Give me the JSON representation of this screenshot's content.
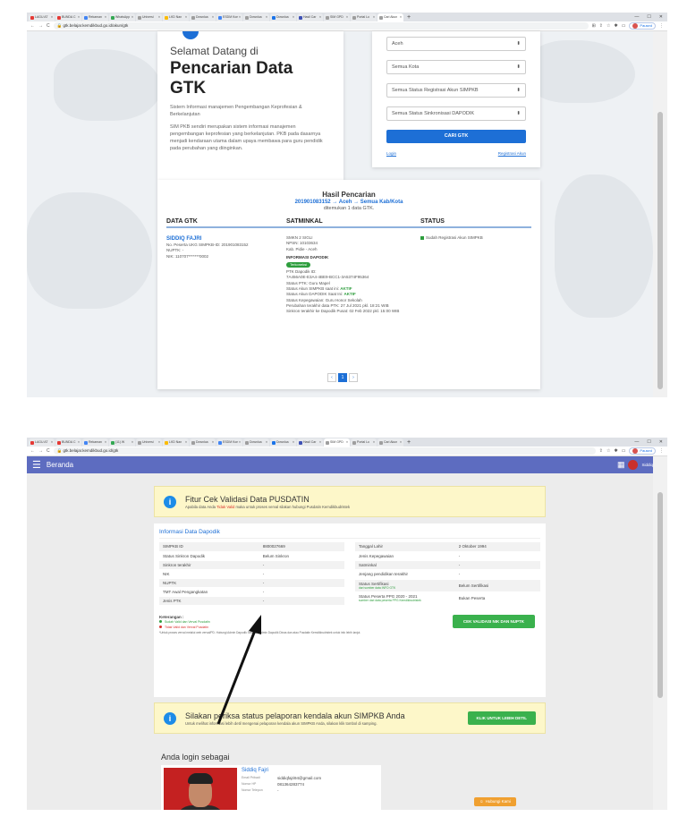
{
  "shot1": {
    "tabs": [
      {
        "label": "LAGU AT",
        "color": "#e53935"
      },
      {
        "label": "BUNDA C",
        "color": "#e53935"
      },
      {
        "label": "Rekaman",
        "color": "#4285f4"
      },
      {
        "label": "WhatsApp",
        "color": "#34a853"
      },
      {
        "label": "Universi",
        "color": "#9e9e9e"
      },
      {
        "label": "LKD Nan",
        "color": "#fbbc05"
      },
      {
        "label": "Downloa",
        "color": "#9e9e9e"
      },
      {
        "label": "ESDM Kon",
        "color": "#4285f4"
      },
      {
        "label": "Downloa",
        "color": "#9e9e9e"
      },
      {
        "label": "Downloa",
        "color": "#1a73e8"
      },
      {
        "label": "Hasil Car",
        "color": "#3f51b5"
      },
      {
        "label": "SIM GPD",
        "color": "#9e9e9e"
      },
      {
        "label": "Portal Lo",
        "color": "#9e9e9e"
      },
      {
        "label": "Cari Akun",
        "color": "#9e9e9e"
      }
    ],
    "url": "gtk.belajar.kemdikbud.go.id/akun/gtk",
    "profile_label": "Paused",
    "welcome": {
      "heading": "Selamat Datang di",
      "title": "Pencarian Data GTK",
      "subtitle": "Sistem Informasi manajemen Pengembangan Keprofesian & Berkelanjutan",
      "paragraph": "SIM PKB sendiri merupakan sistem informasi manajemen pengembangan keprofesian yang berkelanjutan. PKB pada dasarnya menjadi kendaraan utama dalam upaya membawa para guru pendidik pada perubahan yang diinginkan."
    },
    "filters": {
      "province": "Aceh",
      "city": "Semua Kota",
      "registration_status": "Semua Status Registrasi Akun SIMPKB",
      "sync_status": "Semua Status Sinkronisasi DAPODIK",
      "search_button": "CARI GTK",
      "login_link": "Login",
      "register_link": "Registrasi Akun"
    },
    "result": {
      "title": "Hasil Pencarian",
      "query": "201901083152 → Aceh → Semua Kab/Kota",
      "count_text": "ditemukan 1 data GTK.",
      "headers": [
        "DATA GTK",
        "SATMINKAL",
        "STATUS"
      ],
      "name": "SIDDIQ FAJRI",
      "gtk_lines": [
        "No. Peserta UKG SIMPKB-ID: 201901083152",
        "NUPTK: -",
        "NIK: 110707*******0002"
      ],
      "school_lines": [
        "SMKN 2 SIGLI",
        "NPSN: 10103634",
        "Kab. Pidie - Aceh"
      ],
      "dapodik_label": "INFORMASI DAPODIK",
      "dapodik_badge": "Terkoneksi",
      "dapodik_lines": [
        "PTK Dapodik ID:",
        "7A456A0E-E3A4-4BE9-BCC1-3A5374F95364",
        "Status PTK: Guru Mapel",
        "Status Akun SIMPKB saat ini: AKTIF",
        "Status Akun DAPODIK Saat Ini: AKTIF",
        "Status Kepegawaian: Guru Honor Sekolah",
        "Perubahan terakhir data PTK: 27 Jul 2021 pkl. 18:21 WIB",
        "Sinkron terakhir ke Dapodik Pusat: 02 Feb 2022 pkl. 15:00 WIB"
      ],
      "status_text": "Sudah Registrasi Akun SIMPKB",
      "pages": [
        "‹",
        "1",
        "›"
      ]
    }
  },
  "shot2": {
    "tabs": [
      {
        "label": "LAGU AT",
        "color": "#e53935"
      },
      {
        "label": "BUNDA C",
        "color": "#e53935"
      },
      {
        "label": "Rekaman",
        "color": "#4285f4"
      },
      {
        "label": "(11) W",
        "color": "#34a853"
      },
      {
        "label": "Universi",
        "color": "#9e9e9e"
      },
      {
        "label": "LKD Nan",
        "color": "#fbbc05"
      },
      {
        "label": "Downloa",
        "color": "#9e9e9e"
      },
      {
        "label": "ESDM Kon",
        "color": "#4285f4"
      },
      {
        "label": "Downloa",
        "color": "#9e9e9e"
      },
      {
        "label": "Downloa",
        "color": "#1a73e8"
      },
      {
        "label": "Hasil Car",
        "color": "#3f51b5"
      },
      {
        "label": "SIM GPD",
        "color": "#9e9e9e"
      },
      {
        "label": "Portal Lo",
        "color": "#9e9e9e"
      },
      {
        "label": "Cari Akun",
        "color": "#9e9e9e"
      }
    ],
    "url": "gtk.belajar.kemdikbud.go.id/gtk",
    "profile_label": "Paused",
    "app_title": "Beranda",
    "user_name": "Siddiq Fajri",
    "alert1": {
      "title": "Fitur Cek Validasi Data PUSDATIN",
      "text_pre": "Apabila data Anda",
      "text_red": "Tidak Valid",
      "text_post": "maka untuk proses verval silakan hubungi Pusdatin Kemdikbudristek"
    },
    "info": {
      "title": "Informasi Data Dapodik",
      "left": [
        {
          "k": "SIMPKB ID",
          "v": "8800027669"
        },
        {
          "k": "Status Sinkron Dapodik",
          "v": "Belum Sinkron"
        },
        {
          "k": "Sinkron terakhir",
          "v": "-"
        },
        {
          "k": "NIK",
          "v": "-"
        },
        {
          "k": "NUPTK",
          "v": "-"
        },
        {
          "k": "TMT Awal Pengangkatan",
          "v": "-"
        },
        {
          "k": "Jenis PTK",
          "v": "-"
        }
      ],
      "right": [
        {
          "k": "Tanggal Lahir",
          "sub": "",
          "v": "2 Oktober 1994"
        },
        {
          "k": "Jenis Kepegawaian",
          "sub": "",
          "v": "-"
        },
        {
          "k": "Satminkal",
          "sub": "",
          "v": "-"
        },
        {
          "k": "Jenjang pendidikan terakhir",
          "sub": "",
          "v": "-"
        },
        {
          "k": "Status Sertifikasi",
          "sub": "dari sumber data INFO GTK",
          "v": "Belum Sertifikasi"
        },
        {
          "k": "Status Peserta PPG 2020 - 2021",
          "sub": "sumber dari data peserta PPG Kemdikbudristek",
          "v": "Bukan Peserta"
        }
      ],
      "keterangan": "Keterangan :",
      "legend_valid": "Sudah Valid dan Verval Pusdatin",
      "legend_invalid": "Tidak Valid dan Verval Pusdatin",
      "note": "*Untuk proses verval melalui web verval/PD. Hubungi Admin Dapodik Sekolah, Admin Dapodik Dinas dan atau Pusdatin Kemdikbudristek untuk info lebih lanjut.",
      "validate_button": "CEK VALIDASI NIK DAN NUPTK"
    },
    "alert2": {
      "title": "Silakan periksa status pelaporan kendala akun SIMPKB Anda",
      "text": "Untuk melihat informasi lebih detil mengenai pelaporan kendala akun SIMPKB Anda, silakan klik tombol di samping.",
      "button": "KLIK UNTUK LEBIH DETIL"
    },
    "login": {
      "heading": "Anda login sebagai",
      "name": "Siddiq Fajri",
      "rows": [
        {
          "k": "Email Pribadi",
          "v": "siddiqfajri94@gmail.com"
        },
        {
          "k": "Nomor HP",
          "v": "081364283774"
        },
        {
          "k": "Nomor Telepon",
          "v": "-"
        }
      ],
      "help_button": "Hubungi Kami"
    }
  }
}
